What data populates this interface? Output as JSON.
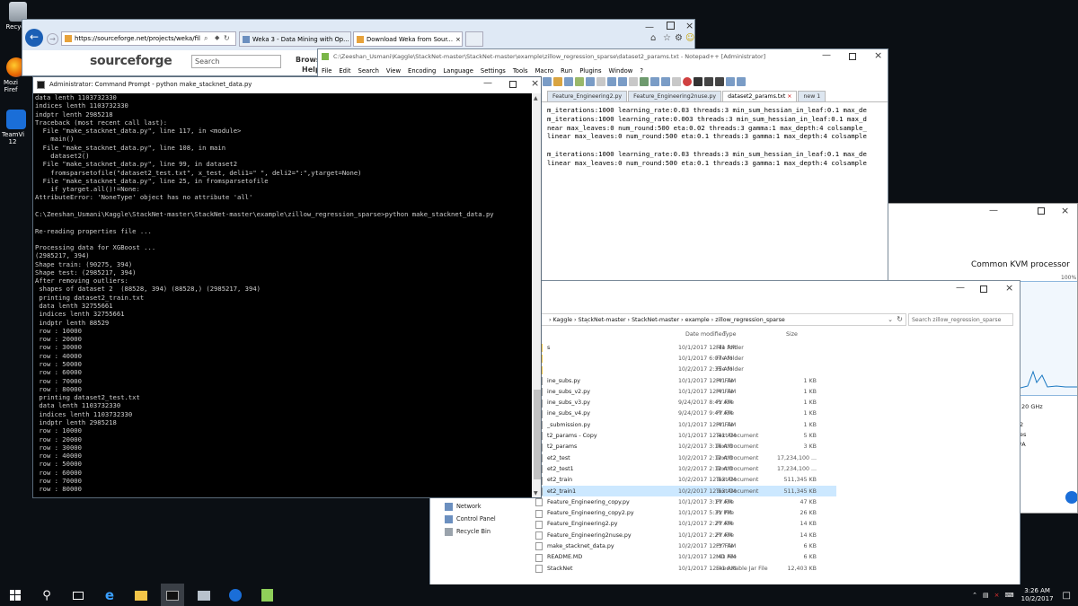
{
  "desktop": {
    "icons": [
      {
        "label": "Recycle",
        "icon": "recycle-bin-icon"
      },
      {
        "label": "Mozi Firef",
        "icon": "firefox-icon"
      },
      {
        "label": "TeamVi 12",
        "icon": "teamviewer-icon"
      }
    ]
  },
  "browser": {
    "url": "https://sourceforge.net/projects/weka/files/i",
    "tabs": [
      {
        "label": "Weka 3 - Data Mining with Op..."
      },
      {
        "label": "Download Weka from Sour..."
      }
    ],
    "logo": "sourceforge",
    "search_placeholder": "Search",
    "browse_label": "Browse",
    "help_label": "Help"
  },
  "notepad": {
    "title": "C:\\Zeeshan_Usmani\\Kaggle\\StackNet-master\\StackNet-master\\example\\zillow_regression_sparse\\dataset2_params.txt - Notepad++ [Administrator]",
    "menu": [
      "File",
      "Edit",
      "Search",
      "View",
      "Encoding",
      "Language",
      "Settings",
      "Tools",
      "Macro",
      "Run",
      "Plugins",
      "Window",
      "?"
    ],
    "tabs": [
      {
        "label": "Feature_Engineering2.py"
      },
      {
        "label": "Feature_Engineering2nuse.py"
      },
      {
        "label": "dataset2_params.txt"
      },
      {
        "label": "new 1"
      }
    ],
    "lines": [
      "m_iterations:1000 learning_rate:0.03 threads:3 min_sum_hessian_in_leaf:0.1 max_de",
      "m_iterations:1000 learning_rate:0.003 threads:3 min_sum_hessian_in_leaf:0.1 max_d",
      "near max_leaves:0 num_round:500 eta:0.02 threads:3 gamma:1 max_depth:4 colsample_",
      "linear max_leaves:0 num_round:500 eta:0.1 threads:3 gamma:1 max_depth:4 colsample",
      "",
      "m_iterations:1000 learning_rate:0.03 threads:3 min_sum_hessian_in_leaf:0.1 max_de",
      "linear max_leaves:0 num_round:500 eta:0.1 threads:3 gamma:1 max_depth:4 colsample"
    ]
  },
  "task_manager": {
    "cpu_label": "Common KVM processor",
    "percent": "100%",
    "side_texts": [
      "20 GHz",
      "2",
      "es",
      "/A"
    ]
  },
  "console": {
    "title": "Administrator: Command Prompt - python  make_stacknet_data.py",
    "text": "data lenth 1103732330\nindices lenth 1103732330\nindptr lenth 2985218\nTraceback (most recent call last):\n  File \"make_stacknet_data.py\", line 117, in <module>\n    main()\n  File \"make_stacknet_data.py\", line 108, in main\n    dataset2()\n  File \"make_stacknet_data.py\", line 99, in dataset2\n    fromsparsetofile(\"dataset2_test.txt\", x_test, deli1=\" \", deli2=\":\",ytarget=None)\n  File \"make_stacknet_data.py\", line 25, in fromsparsetofile\n    if ytarget.all()!=None:\nAttributeError: 'NoneType' object has no attribute 'all'\n\nC:\\Zeeshan_Usmani\\Kaggle\\StackNet-master\\StackNet-master\\example\\zillow_regression_sparse>python make_stacknet_data.py\n\nRe-reading properties file ...\n\nProcessing data for XGBoost ...\n(2985217, 394)\nShape train: (90275, 394)\nShape test: (2985217, 394)\nAfter removing outliers:\n shapes of dataset 2  (88528, 394) (88528,) (2985217, 394)\n printing dataset2_train.txt\n data lenth 32755661\n indices lenth 32755661\n indptr lenth 88529\n row : 10000\n row : 20000\n row : 30000\n row : 40000\n row : 50000\n row : 60000\n row : 70000\n row : 80000\n printing dataset2_test.txt\n data lenth 1103732330\n indices lenth 1103732330\n indptr lenth 2985218\n row : 10000\n row : 20000\n row : 30000\n row : 40000\n row : 50000\n row : 60000\n row : 70000\n row : 80000"
  },
  "explorer": {
    "breadcrumb": [
      "Kaggle",
      "StackNet-master",
      "StackNet-master",
      "example",
      "zillow_regression_sparse"
    ],
    "search_placeholder": "Search zillow_regression_sparse",
    "columns": {
      "date": "Date modified",
      "type": "Type",
      "size": "Size"
    },
    "sidebar": [
      {
        "label": "Network",
        "icon": "network-icon"
      },
      {
        "label": "Control Panel",
        "icon": "control-panel-icon"
      },
      {
        "label": "Recycle Bin",
        "icon": "recycle-bin-icon"
      }
    ],
    "files": [
      {
        "name": "s",
        "date": "10/1/2017 12:41 AM",
        "type": "File folder",
        "size": ""
      },
      {
        "name": "",
        "date": "10/1/2017 6:07 AM",
        "type": "File folder",
        "size": ""
      },
      {
        "name": "",
        "date": "10/2/2017 2:35 AM",
        "type": "File folder",
        "size": ""
      },
      {
        "name": "ine_subs.py",
        "date": "10/1/2017 12:41 AM",
        "type": "PY File",
        "size": "1 KB"
      },
      {
        "name": "ine_subs_v2.py",
        "date": "10/1/2017 12:41 AM",
        "type": "PY File",
        "size": "1 KB"
      },
      {
        "name": "ine_subs_v3.py",
        "date": "9/24/2017 8:41 AM",
        "type": "PY File",
        "size": "1 KB"
      },
      {
        "name": "ine_subs_v4.py",
        "date": "9/24/2017 9:47 AM",
        "type": "PY File",
        "size": "1 KB"
      },
      {
        "name": "_submission.py",
        "date": "10/1/2017 12:41 AM",
        "type": "PY File",
        "size": "1 KB"
      },
      {
        "name": "t2_params - Copy",
        "date": "10/1/2017 12:41 AM",
        "type": "Text Document",
        "size": "5 KB"
      },
      {
        "name": "t2_params",
        "date": "10/2/2017 3:16 AM",
        "type": "Text Document",
        "size": "3 KB"
      },
      {
        "name": "et2_test",
        "date": "10/2/2017 2:12 AM",
        "type": "Text Document",
        "size": "17,234,100 ..."
      },
      {
        "name": "et2_test1",
        "date": "10/2/2017 2:12 AM",
        "type": "Text Document",
        "size": "17,234,100 ..."
      },
      {
        "name": "et2_train",
        "date": "10/2/2017 12:53 AM",
        "type": "Text Document",
        "size": "511,345 KB"
      },
      {
        "name": "et2_train1",
        "date": "10/2/2017 12:53 AM",
        "type": "Text Document",
        "size": "511,345 KB",
        "selected": true
      },
      {
        "name": "Feature_Engineering_copy.py",
        "date": "10/1/2017 3:17 AM",
        "type": "PY File",
        "size": "47 KB"
      },
      {
        "name": "Feature_Engineering_copy2.py",
        "date": "10/1/2017 5:31 PM",
        "type": "PY File",
        "size": "26 KB"
      },
      {
        "name": "Feature_Engineering2.py",
        "date": "10/1/2017 2:27 AM",
        "type": "PY File",
        "size": "14 KB"
      },
      {
        "name": "Feature_Engineering2nuse.py",
        "date": "10/1/2017 2:27 AM",
        "type": "PY File",
        "size": "14 KB"
      },
      {
        "name": "make_stacknet_data.py",
        "date": "10/2/2017 12:37 AM",
        "type": "PY File",
        "size": "6 KB"
      },
      {
        "name": "README.MD",
        "date": "10/1/2017 12:41 AM",
        "type": "MD File",
        "size": "6 KB"
      },
      {
        "name": "StackNet",
        "date": "10/1/2017 12:41 AM",
        "type": "Executable Jar File",
        "size": "12,403 KB"
      }
    ]
  },
  "taskbar": {
    "time": "3:26 AM",
    "date": "10/2/2017"
  }
}
